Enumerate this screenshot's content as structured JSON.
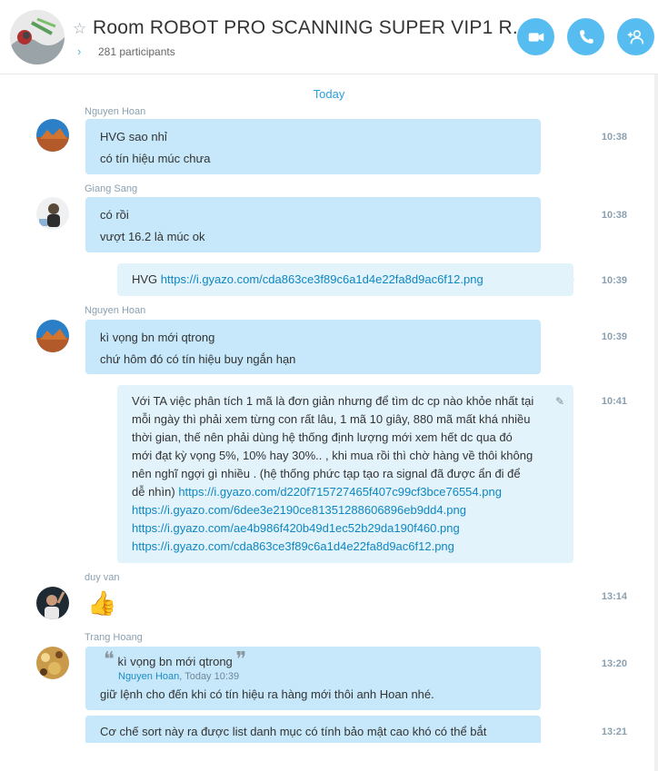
{
  "header": {
    "title": "Room ROBOT PRO SCANNING SUPER VIP1 R...",
    "participants": "281 participants"
  },
  "day_separator": "Today",
  "messages": [
    {
      "sender": "Nguyen Hoan",
      "lines": [
        "HVG sao nhỉ",
        "có tín hiệu múc chưa"
      ],
      "time": "10:38"
    },
    {
      "sender": "Giang Sang",
      "lines": [
        "có rồi",
        "vượt 16.2 là múc ok"
      ],
      "time": "10:38"
    },
    {
      "prefix": "HVG ",
      "link": "https://i.gyazo.com/cda863ce3f89c6a1d4e22fa8d9ac6f12.png",
      "time": "10:39"
    },
    {
      "sender": "Nguyen Hoan",
      "lines": [
        "kì vọng bn mới qtrong",
        "chứ hôm đó có tín hiệu buy ngắn hạn"
      ],
      "time": "10:39"
    },
    {
      "text_lines": [
        "Với TA việc phân tích 1 mã là đơn giản nhưng để tìm dc cp nào khỏe nhất tại",
        "mỗi ngày thì phải xem từng con rất lâu, 1 mã 10 giây, 880 mã mất khá nhiều",
        "thời gian, thế nên phải dùng hệ thống định lượng mới xem hết dc qua đó",
        "mới đạt kỳ vọng 5%, 10% hay 30%.. , khi mua rồi thì chờ hàng về thôi không",
        "nên nghĩ ngợi gì nhiều . (hệ thống phức tạp tạo ra signal đã được ẩn đi để"
      ],
      "last_prefix": "dễ nhìn) ",
      "links": [
        "https://i.gyazo.com/d220f715727465f407c99cf3bce76554.png",
        "https://i.gyazo.com/6dee3e2190ce81351288606896eb9dd4.png",
        "https://i.gyazo.com/ae4b986f420b49d1ec52b29da190f460.png",
        "https://i.gyazo.com/cda863ce3f89c6a1d4e22fa8d9ac6f12.png"
      ],
      "time": "10:41"
    },
    {
      "sender": "duy van",
      "emoji": "👍",
      "time": "13:14"
    },
    {
      "sender": "Trang Hoang",
      "quote_text": "kì vọng bn mới qtrong",
      "quote_author": "Nguyen Hoan",
      "quote_time": "Today 10:39",
      "reply": "giữ lệnh cho đến khi có tín hiệu ra hàng mới thôi anh Hoan nhé.",
      "time": "13:20"
    },
    {
      "line": "Cơ chế sort này ra được list danh mục có tính bảo mật cao khó có thể bắt",
      "time": "13:21"
    }
  ],
  "icons": {
    "video": "video-call-icon",
    "call": "phone-icon",
    "add": "add-participant-icon",
    "star": "star-icon"
  },
  "colors": {
    "accent": "#57bdf0",
    "incoming_bubble": "#c6e8fa",
    "outgoing_bubble": "#e3f3fc"
  }
}
